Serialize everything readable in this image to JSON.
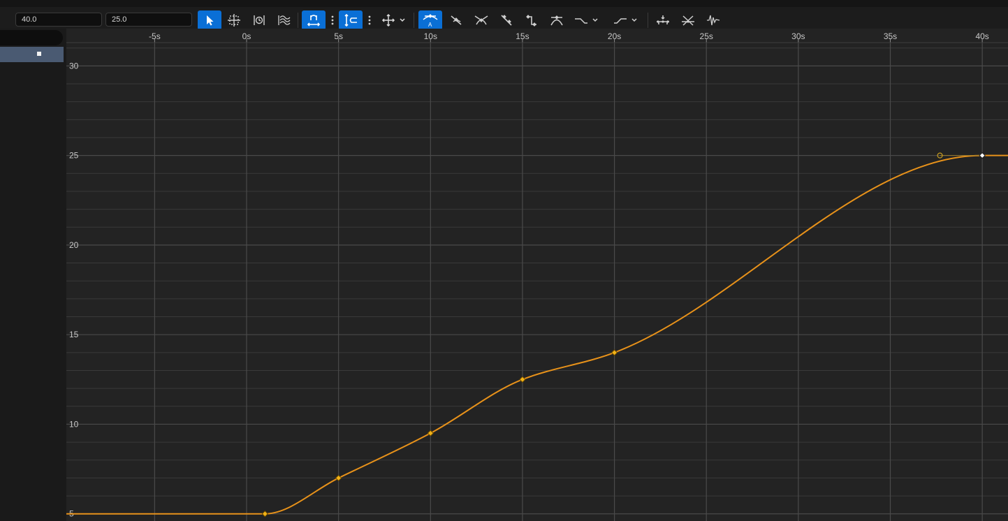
{
  "toolbar": {
    "time_value": "40.0",
    "key_value": "25.0",
    "tools": [
      {
        "name": "select-arrow-icon",
        "active": true
      },
      {
        "name": "transform-keys-icon",
        "active": false
      },
      {
        "name": "retime-icon",
        "active": false
      },
      {
        "name": "multi-curve-icon",
        "active": false
      },
      {
        "name": "snap-time-icon",
        "active": true
      },
      {
        "name": "snap-value-icon",
        "active": true
      },
      {
        "name": "move-axis-icon",
        "active": false
      },
      {
        "name": "auto-tangent-icon",
        "active": true
      },
      {
        "name": "user-tangent-icon",
        "active": false
      },
      {
        "name": "break-tangent-icon",
        "active": false
      },
      {
        "name": "linear-tangent-icon",
        "active": false
      },
      {
        "name": "constant-tangent-icon",
        "active": false
      },
      {
        "name": "flatten-tangent-icon",
        "active": false
      },
      {
        "name": "pre-infinity-icon",
        "active": false
      },
      {
        "name": "post-infinity-icon",
        "active": false
      },
      {
        "name": "reduce-keys-icon",
        "active": false
      },
      {
        "name": "bake-keys-icon",
        "active": false
      },
      {
        "name": "filter-curve-icon",
        "active": false
      }
    ]
  },
  "chart_data": {
    "type": "line",
    "xlabel": "",
    "ylabel": "",
    "xlim": [
      -9.8,
      41.4
    ],
    "ylim": [
      4.6,
      31.3
    ],
    "x_ticks": [
      "-5s",
      "0s",
      "5s",
      "10s",
      "15s",
      "20s",
      "25s",
      "30s",
      "35s",
      "40s"
    ],
    "x_tick_values": [
      -5,
      0,
      5,
      10,
      15,
      20,
      25,
      30,
      35,
      40
    ],
    "y_ticks": [
      "30",
      "25",
      "20",
      "15",
      "10",
      "5"
    ],
    "y_tick_values": [
      30,
      25,
      20,
      15,
      10,
      5
    ],
    "grid": true,
    "series": [
      {
        "color": "#e8921a",
        "keys": [
          {
            "x": 1.0,
            "y": 5.0
          },
          {
            "x": 5.0,
            "y": 7.0
          },
          {
            "x": 10.0,
            "y": 9.5
          },
          {
            "x": 15.0,
            "y": 12.5
          },
          {
            "x": 20.0,
            "y": 14.0
          },
          {
            "x": 40.0,
            "y": 25.0
          }
        ],
        "tangent_handle": {
          "x": 37.7,
          "y": 25.0
        },
        "selected_key": 5
      }
    ]
  }
}
